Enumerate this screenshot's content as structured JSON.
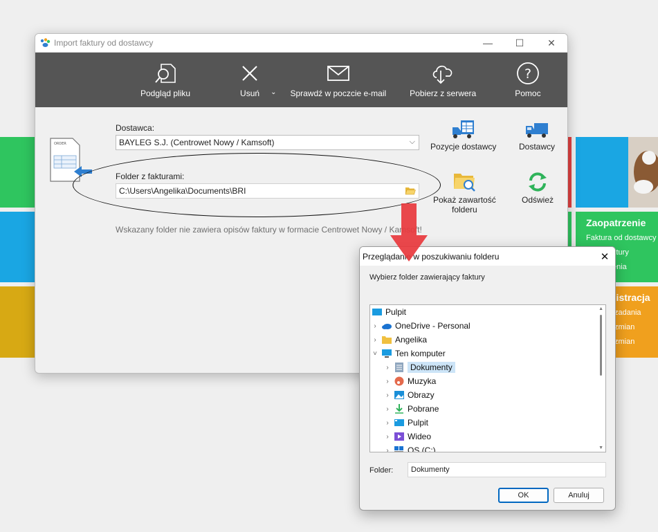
{
  "window": {
    "title": "Import faktury od dostawcy",
    "controls": {
      "minimize": "—",
      "maximize": "☐",
      "close": "✕"
    }
  },
  "toolbar": {
    "preview": "Podgląd pliku",
    "delete": "Usuń",
    "email": "Sprawdź w poczcie e-mail",
    "server": "Pobierz z serwera",
    "help": "Pomoc"
  },
  "form": {
    "supplier_label": "Dostawca:",
    "supplier_value": "BAYLEG S.J. (Centrowet Nowy / Kamsoft)",
    "folder_label": "Folder z fakturami:",
    "folder_value": "C:\\Users\\Angelika\\Documents\\BRI",
    "warning": "Wskazany folder nie zawiera opisów faktury w formacie Centrowet Nowy / Kamsoft!"
  },
  "right_buttons": {
    "positions": "Pozycje dostawcy",
    "suppliers": "Dostawcy",
    "show_folder": [
      "Pokaż zawartość",
      "folderu"
    ],
    "refresh": "Odśwież"
  },
  "background": {
    "supply_title": "Zaopatrzenie",
    "supply_items": [
      "Faktura od dostawcy",
      "ktury",
      "enia"
    ],
    "admin_title": "nistracja",
    "admin_items": [
      "zadania",
      "zmian",
      "zmian"
    ]
  },
  "dialog": {
    "title": "Przeglądanie w poszukiwaniu folderu",
    "subtitle": "Wybierz folder zawierający faktury",
    "tree": [
      {
        "label": "Pulpit",
        "level": 0,
        "arrow": "",
        "icon": "desktop-icon"
      },
      {
        "label": "OneDrive - Personal",
        "level": 1,
        "arrow": "›",
        "icon": "onedrive-icon"
      },
      {
        "label": "Angelika",
        "level": 1,
        "arrow": "›",
        "icon": "folder-icon"
      },
      {
        "label": "Ten komputer",
        "level": 1,
        "arrow": "˅",
        "icon": "computer-icon"
      },
      {
        "label": "Dokumenty",
        "level": 2,
        "arrow": "›",
        "icon": "documents-icon",
        "selected": true
      },
      {
        "label": "Muzyka",
        "level": 2,
        "arrow": "›",
        "icon": "music-icon"
      },
      {
        "label": "Obrazy",
        "level": 2,
        "arrow": "›",
        "icon": "pictures-icon"
      },
      {
        "label": "Pobrane",
        "level": 2,
        "arrow": "›",
        "icon": "download-icon"
      },
      {
        "label": "Pulpit",
        "level": 2,
        "arrow": "›",
        "icon": "desktop-icon"
      },
      {
        "label": "Wideo",
        "level": 2,
        "arrow": "›",
        "icon": "video-icon"
      },
      {
        "label": "OS (C:)",
        "level": 2,
        "arrow": "›",
        "icon": "drive-icon"
      }
    ],
    "folder_label": "Folder:",
    "folder_value": "Dokumenty",
    "ok": "OK",
    "cancel": "Anuluj",
    "close": "✕"
  },
  "colors": {
    "toolbar_bg": "#555555",
    "selection": "#cce4f7",
    "accent": "#0067c0",
    "arrow_red": "#e8383d"
  }
}
